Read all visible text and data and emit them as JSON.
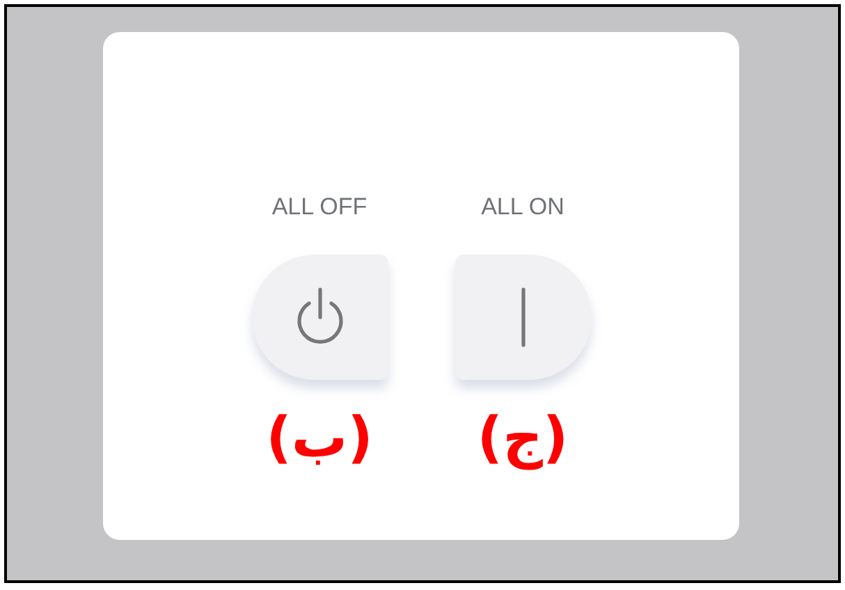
{
  "switches": [
    {
      "kind": "on",
      "label": "ALL ON"
    },
    {
      "kind": "off",
      "label": "ALL OFF"
    }
  ],
  "annotations": [
    "(ج)",
    "(ب)"
  ]
}
